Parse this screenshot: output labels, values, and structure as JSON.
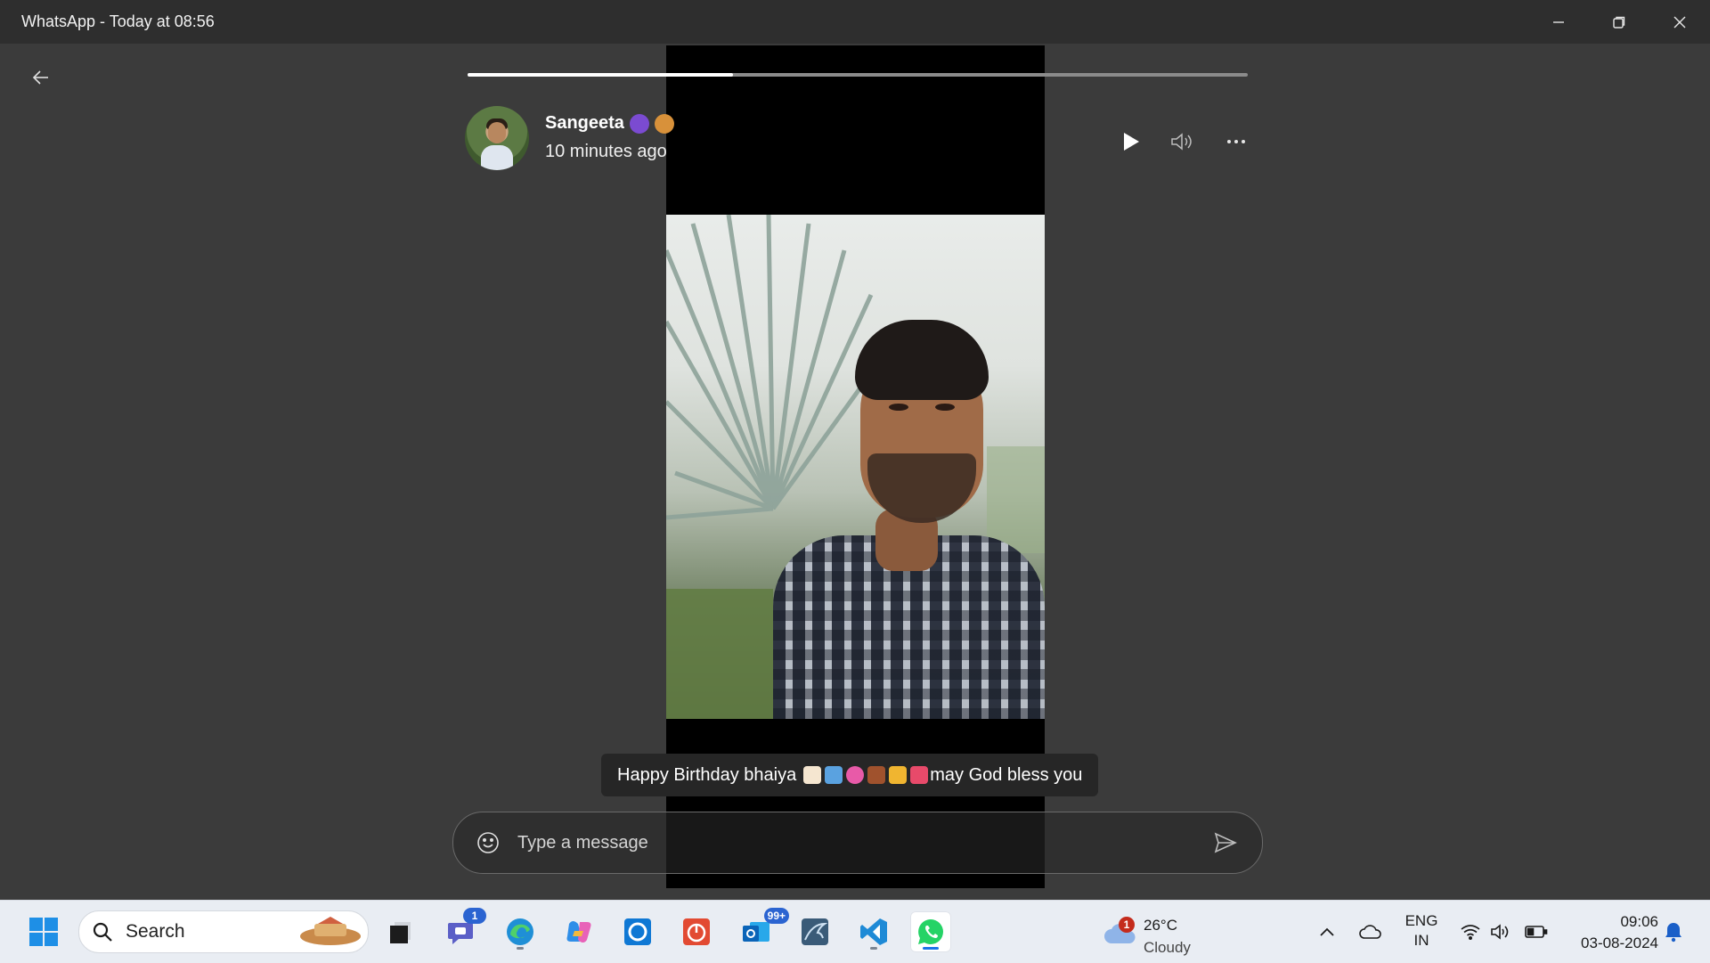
{
  "window": {
    "title": "WhatsApp - Today at 08:56"
  },
  "status": {
    "progress_fraction": 0.34,
    "contact_name": "Sangeeta",
    "time_ago": "10 minutes ago",
    "caption": "Happy Birthday bhaiya",
    "caption_tail": "may God bless you"
  },
  "composer": {
    "placeholder": "Type a message"
  },
  "taskbar": {
    "search_label": "Search",
    "teams_badge": "1",
    "outlook_badge": "99+",
    "weather_badge": "1",
    "weather_temp": "26°C",
    "weather_condition": "Cloudy",
    "lang_line1": "ENG",
    "lang_line2": "IN",
    "time": "09:06",
    "date": "03-08-2024"
  },
  "colors": {
    "accent": "#1a73e8",
    "viewer_bg": "#3b3b3b",
    "video_bg": "#000000",
    "whatsapp_green": "#25d366"
  },
  "icons": {
    "back": "arrow-left-icon",
    "play": "play-icon",
    "volume": "volume-icon",
    "more": "more-icon",
    "emoji": "smiley-icon",
    "send": "send-icon"
  }
}
